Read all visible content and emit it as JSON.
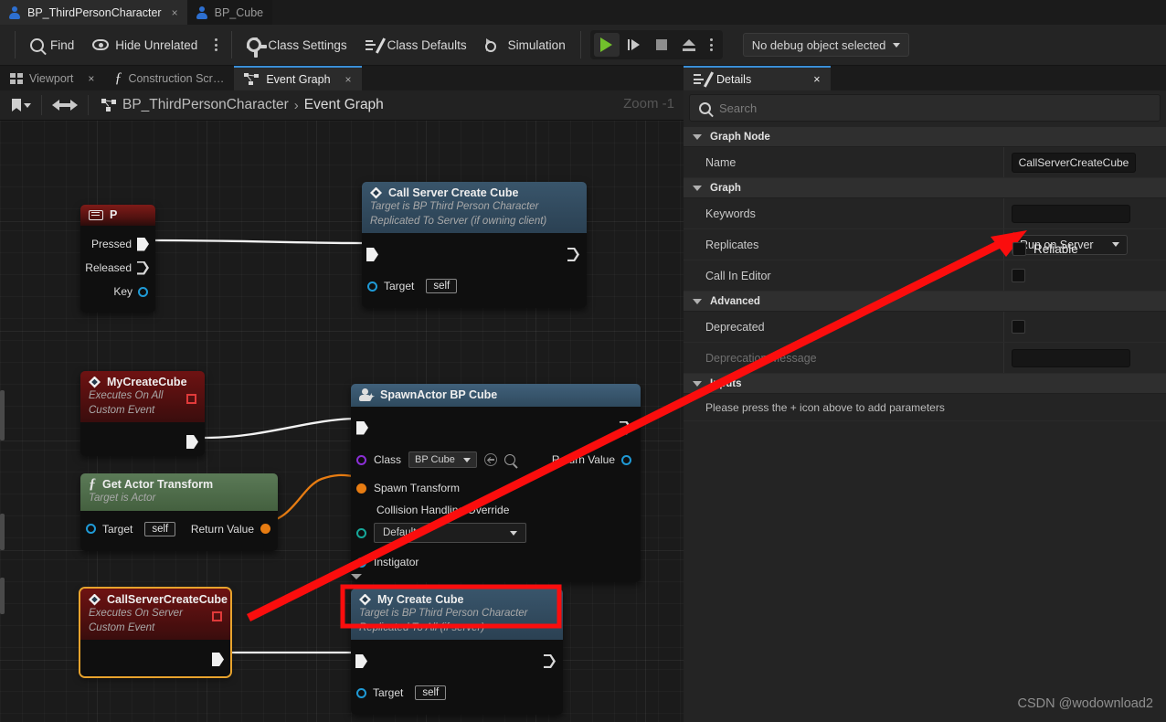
{
  "app": {
    "asset_tabs": [
      {
        "label": "BP_ThirdPersonCharacter",
        "icon": "blueprint-character-icon",
        "active": true,
        "close": "×"
      },
      {
        "label": "BP_Cube",
        "icon": "blueprint-character-icon",
        "active": false,
        "close": ""
      }
    ]
  },
  "toolbar": {
    "find_label": "Find",
    "hide_unrelated_label": "Hide Unrelated",
    "class_settings_label": "Class Settings",
    "class_defaults_label": "Class Defaults",
    "simulation_label": "Simulation",
    "debug_object_label": "No debug object selected",
    "icons": [
      "find-icon",
      "hide-unrelated-icon",
      "overflow-kebab-icon",
      "gear-icon",
      "class-defaults-icon",
      "simulation-icon",
      "play-icon",
      "step-icon",
      "stop-icon",
      "eject-icon"
    ]
  },
  "panel_tabs": {
    "left": [
      {
        "label": "Viewport",
        "icon": "viewport-icon",
        "active": false,
        "close": "×"
      },
      {
        "label": "Construction Scr…",
        "icon": "function-icon",
        "active": false,
        "close": ""
      },
      {
        "label": "Event Graph",
        "icon": "event-graph-icon",
        "active": true,
        "close": "×"
      }
    ],
    "right": [
      {
        "label": "Details",
        "icon": "details-icon",
        "active": true,
        "close": "×"
      }
    ]
  },
  "graph_bar": {
    "breadcrumb_root": "BP_ThirdPersonCharacter",
    "breadcrumb_sep": "›",
    "breadcrumb_current": "Event Graph",
    "zoom_label": "Zoom -1",
    "back_icon": "back-arrow-icon",
    "forward_icon": "forward-arrow-icon",
    "bookmark_icon": "bookmark-icon",
    "graph_icon": "event-graph-icon"
  },
  "nodes": {
    "key_p": {
      "title": "P",
      "icon": "keyboard-icon",
      "pins": [
        {
          "label": "Pressed",
          "type": "exec-out",
          "connected": true
        },
        {
          "label": "Released",
          "type": "exec-out",
          "connected": false
        },
        {
          "label": "Key",
          "type": "data-out-blue"
        }
      ]
    },
    "call_server_create_cube": {
      "title": "Call Server Create Cube",
      "subtitle_1": "Target is BP Third Person Character",
      "subtitle_2": "Replicated To Server (if owning client)",
      "icon": "custom-event-icon",
      "target_label": "Target",
      "target_value": "self"
    },
    "my_create_cube_event": {
      "title": "MyCreateCube",
      "subtitle_1": "Executes On All",
      "subtitle_2": "Custom Event",
      "icon": "custom-event-icon",
      "replicated_badge": "replicated-icon"
    },
    "get_actor_transform": {
      "title": "Get Actor Transform",
      "subtitle_1": "Target is Actor",
      "icon": "function-icon",
      "target_label": "Target",
      "target_value": "self",
      "return_label": "Return Value"
    },
    "spawn_actor": {
      "title": "SpawnActor BP Cube",
      "icon": "spawn-actor-icon",
      "class_label": "Class",
      "class_value": "BP Cube",
      "spawn_transform_label": "Spawn Transform",
      "collision_label": "Collision Handling Override",
      "collision_value": "Default",
      "instigator_label": "Instigator",
      "return_label": "Return Value",
      "expand_icon": "chevron-down-icon"
    },
    "call_server_create_cube_event": {
      "title": "CallServerCreateCube",
      "subtitle_1": "Executes On Server",
      "subtitle_2": "Custom Event",
      "icon": "custom-event-icon",
      "replicated_badge": "replicated-icon",
      "selected": true
    },
    "my_create_cube_call": {
      "title": "My Create Cube",
      "subtitle_1": "Target is BP Third Person Character",
      "subtitle_2": "Replicated To All (if server)",
      "icon": "custom-event-icon",
      "target_label": "Target",
      "target_value": "self"
    }
  },
  "details": {
    "search_placeholder": "Search",
    "search_value": "",
    "search_icon": "search-icon",
    "sections": [
      {
        "name": "Graph Node",
        "rows": [
          {
            "label": "Name",
            "kind": "text-filled",
            "value": "CallServerCreateCube"
          }
        ]
      },
      {
        "name": "Graph",
        "rows": [
          {
            "label": "Keywords",
            "kind": "text",
            "value": ""
          },
          {
            "label": "Replicates",
            "kind": "select",
            "value": "Run on Server"
          },
          {
            "label": "Reliable",
            "kind": "checkbox-inline",
            "value": false
          },
          {
            "label": "Call In Editor",
            "kind": "checkbox",
            "value": false
          }
        ]
      },
      {
        "name": "Advanced",
        "rows": [
          {
            "label": "Deprecated",
            "kind": "checkbox",
            "value": false
          },
          {
            "label": "Deprecation Message",
            "kind": "text",
            "value": "",
            "disabled": true
          }
        ]
      },
      {
        "name": "Inputs",
        "rows": [
          {
            "label": "Please press the + icon above to add parameters",
            "kind": "note"
          }
        ]
      }
    ]
  },
  "annotations": {
    "arrow_color": "#fb0d0d",
    "highlight_box_color": "#fb0d0d",
    "selection_color": "#e8a32d"
  },
  "watermark": "CSDN @wodownload2",
  "colors": {
    "accent_tab": "#3a8fd8",
    "exec_wire": "#f2f2f2",
    "data_wire_orange": "#e77c12",
    "node_red": "#6e1212",
    "node_blue": "#39556b",
    "node_green": "#5b7a57"
  }
}
